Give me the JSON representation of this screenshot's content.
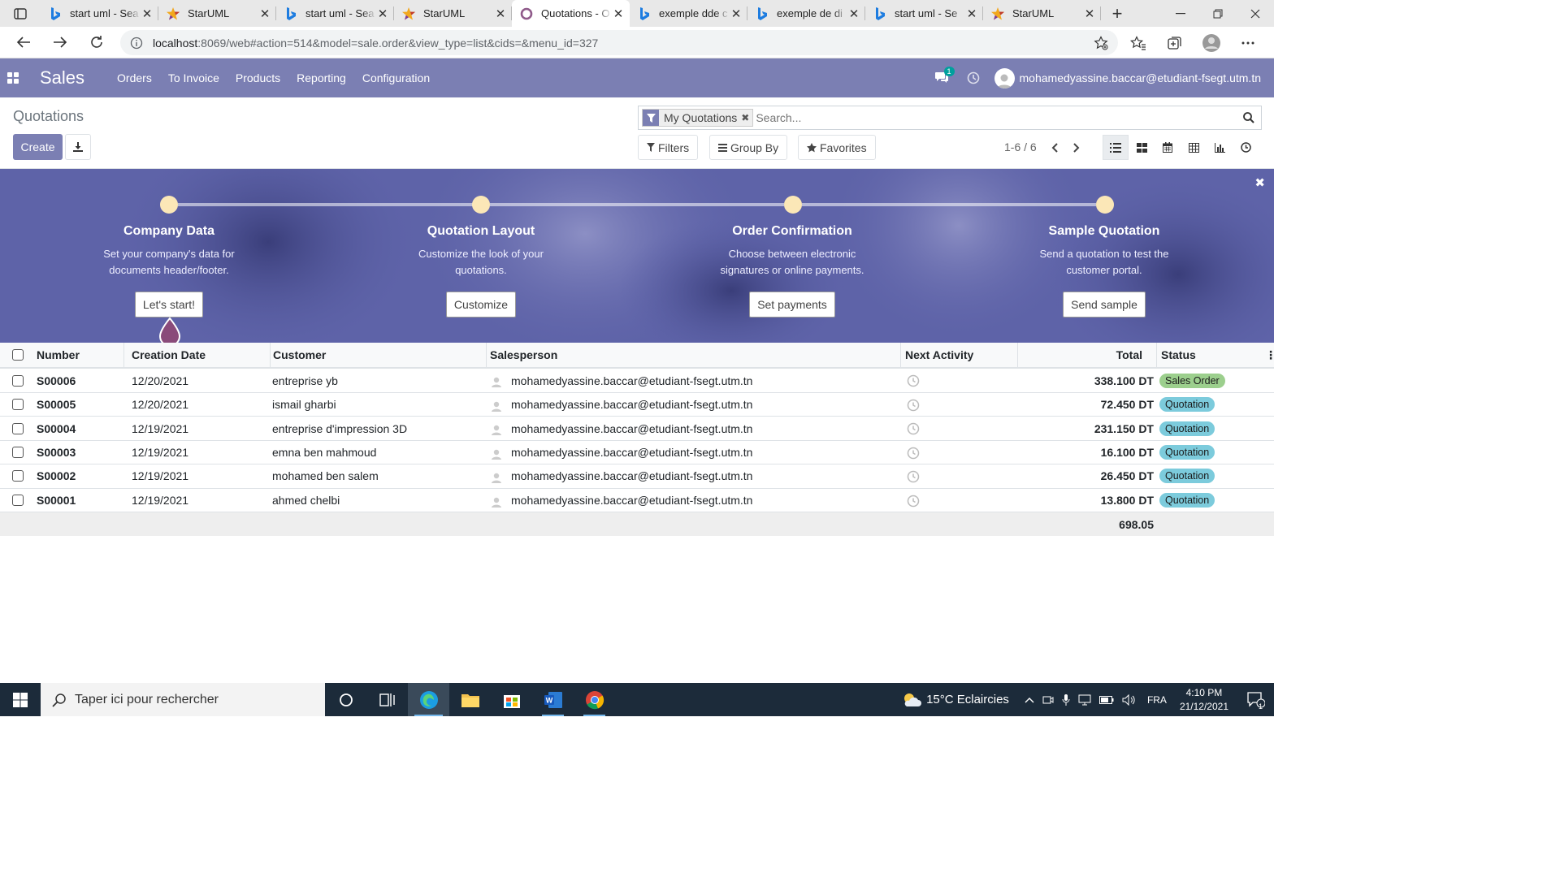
{
  "browser": {
    "tabs": [
      {
        "title": "start uml - Sea",
        "icon": "bing-icon",
        "active": false
      },
      {
        "title": "StarUML",
        "icon": "staruml-icon",
        "active": false
      },
      {
        "title": "start uml - Sea",
        "icon": "bing-icon",
        "active": false
      },
      {
        "title": "StarUML",
        "icon": "staruml-icon",
        "active": false
      },
      {
        "title": "Quotations - O",
        "icon": "odoo-icon",
        "active": true
      },
      {
        "title": "exemple dde c",
        "icon": "bing-icon",
        "active": false
      },
      {
        "title": "exemple de di",
        "icon": "bing-icon",
        "active": false
      },
      {
        "title": "start uml - Se",
        "icon": "bing-icon",
        "active": false
      },
      {
        "title": "StarUML",
        "icon": "staruml-icon",
        "active": false
      }
    ],
    "url_host": "localhost",
    "url_rest": ":8069/web#action=514&model=sale.order&view_type=list&cids=&menu_id=327"
  },
  "navbar": {
    "brand": "Sales",
    "menu": [
      "Orders",
      "To Invoice",
      "Products",
      "Reporting",
      "Configuration"
    ],
    "chat_count": "1",
    "user": "mohamedyassine.baccar@etudiant-fsegt.utm.tn",
    "accent": "#7b7fb3"
  },
  "control_panel": {
    "title": "Quotations",
    "create_label": "Create",
    "facet_label": "My Quotations",
    "search_placeholder": "Search...",
    "filters_label": "Filters",
    "groupby_label": "Group By",
    "favorites_label": "Favorites",
    "pager": "1-6 / 6"
  },
  "banner": {
    "steps": [
      {
        "title": "Company Data",
        "desc": "Set your company's data for documents header/footer.",
        "button": "Let's start!"
      },
      {
        "title": "Quotation Layout",
        "desc": "Customize the look of your quotations.",
        "button": "Customize"
      },
      {
        "title": "Order Confirmation",
        "desc": "Choose between electronic signatures or online payments.",
        "button": "Set payments"
      },
      {
        "title": "Sample Quotation",
        "desc": "Send a quotation to test the customer portal.",
        "button": "Send sample"
      }
    ]
  },
  "table": {
    "headers": {
      "number": "Number",
      "date": "Creation Date",
      "customer": "Customer",
      "salesperson": "Salesperson",
      "activity": "Next Activity",
      "total": "Total",
      "status": "Status"
    },
    "rows": [
      {
        "number": "S00006",
        "date": "12/20/2021",
        "customer": "entreprise yb",
        "salesperson": "mohamedyassine.baccar@etudiant-fsegt.utm.tn",
        "total": "338.100 DT",
        "status": "Sales Order",
        "status_color": "#9ccf8d"
      },
      {
        "number": "S00005",
        "date": "12/20/2021",
        "customer": "ismail gharbi",
        "salesperson": "mohamedyassine.baccar@etudiant-fsegt.utm.tn",
        "total": "72.450 DT",
        "status": "Quotation",
        "status_color": "#7ccbdc"
      },
      {
        "number": "S00004",
        "date": "12/19/2021",
        "customer": "entreprise d'impression 3D",
        "salesperson": "mohamedyassine.baccar@etudiant-fsegt.utm.tn",
        "total": "231.150 DT",
        "status": "Quotation",
        "status_color": "#7ccbdc"
      },
      {
        "number": "S00003",
        "date": "12/19/2021",
        "customer": "emna ben mahmoud",
        "salesperson": "mohamedyassine.baccar@etudiant-fsegt.utm.tn",
        "total": "16.100 DT",
        "status": "Quotation",
        "status_color": "#7ccbdc"
      },
      {
        "number": "S00002",
        "date": "12/19/2021",
        "customer": "mohamed ben salem",
        "salesperson": "mohamedyassine.baccar@etudiant-fsegt.utm.tn",
        "total": "26.450 DT",
        "status": "Quotation",
        "status_color": "#7ccbdc"
      },
      {
        "number": "S00001",
        "date": "12/19/2021",
        "customer": "ahmed chelbi",
        "salesperson": "mohamedyassine.baccar@etudiant-fsegt.utm.tn",
        "total": "13.800 DT",
        "status": "Quotation",
        "status_color": "#7ccbdc"
      }
    ],
    "footer_total": "698.05"
  },
  "taskbar": {
    "search_placeholder": "Taper ici pour rechercher",
    "weather": "15°C  Eclaircies",
    "lang": "FRA",
    "time": "4:10 PM",
    "date": "21/12/2021",
    "notif_count": "1"
  }
}
